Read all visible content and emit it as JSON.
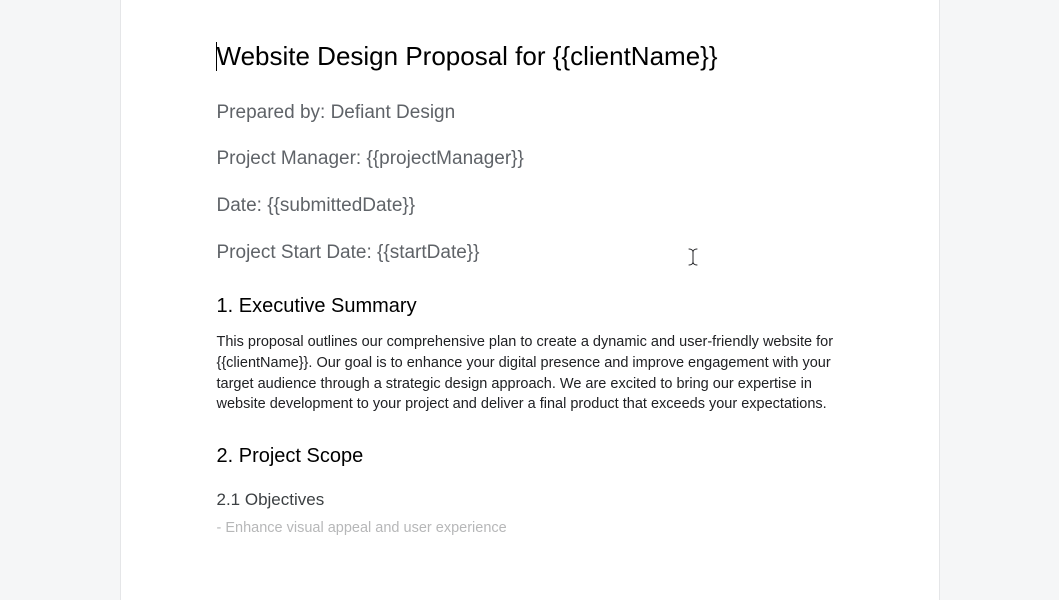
{
  "document": {
    "title": "Website Design Proposal for {{clientName}}",
    "meta": {
      "preparedBy": "Prepared by: Defiant Design",
      "projectManager": "Project Manager: {{projectManager}}",
      "date": "Date: {{submittedDate}}",
      "startDate": "Project Start Date: {{startDate}}"
    },
    "sections": {
      "execSummary": {
        "heading": "1. Executive Summary",
        "body": "This proposal outlines our comprehensive plan to create a dynamic and user-friendly website for {{clientName}}. Our goal is to enhance your digital presence and improve engagement with your target audience through a strategic design approach. We are excited to bring our expertise in website development to your project and deliver a final product that exceeds your expectations."
      },
      "scope": {
        "heading": "2. Project Scope",
        "objectives": {
          "heading": "2.1 Objectives",
          "bullet1": "- Enhance visual appeal and user experience"
        }
      }
    }
  }
}
